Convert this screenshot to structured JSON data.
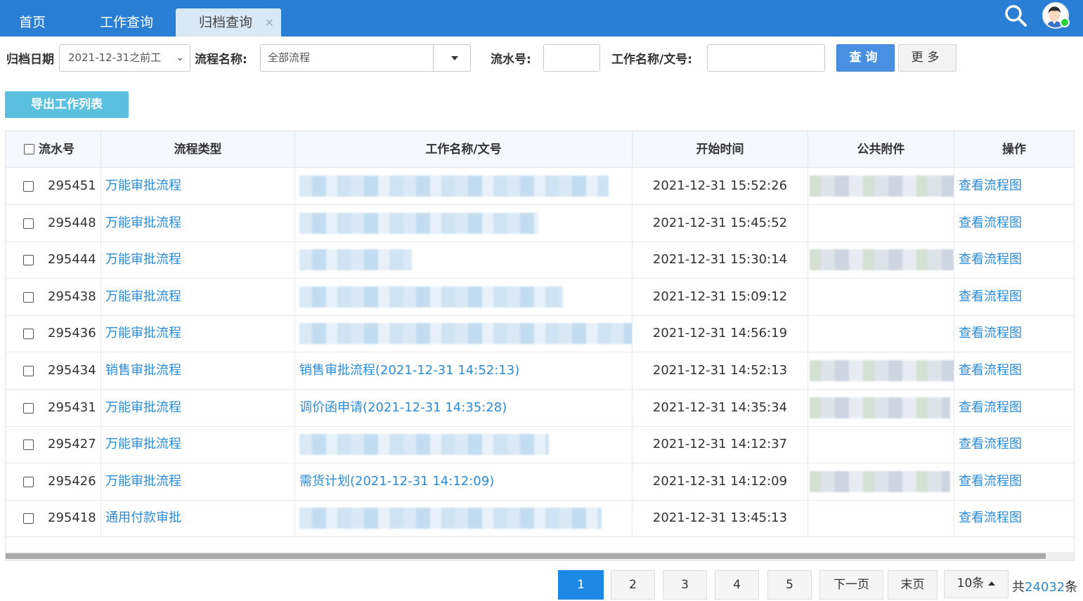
{
  "tabs": [
    {
      "label": "首页"
    },
    {
      "label": "工作查询"
    },
    {
      "label": "归档查询",
      "close": "×"
    }
  ],
  "filters": {
    "date_label": "归档日期",
    "date_value": "2021-12-31之前工",
    "flow_label": "流程名称:",
    "flow_value": "全部流程",
    "serial_label": "流水号:",
    "serial_value": "",
    "name_label": "工作名称/文号:",
    "name_value": "",
    "query_button": "查询",
    "more_button": "更多"
  },
  "export_button": "导出工作列表",
  "table": {
    "headers": {
      "serial": "流水号",
      "type": "流程类型",
      "name": "工作名称/文号",
      "start_time": "开始时间",
      "attachment": "公共附件",
      "operation": "操作"
    },
    "rows": [
      {
        "serial": "295451",
        "type": "万能审批流程",
        "name": "",
        "name_blurred": true,
        "time": "2021-12-31 15:52:26",
        "attachment_blurred": true,
        "op": "查看流程图"
      },
      {
        "serial": "295448",
        "type": "万能审批流程",
        "name": "",
        "name_blurred": true,
        "time": "2021-12-31 15:45:52",
        "attachment_blurred": false,
        "op": "查看流程图"
      },
      {
        "serial": "295444",
        "type": "万能审批流程",
        "name": "",
        "name_blurred": true,
        "time": "2021-12-31 15:30:14",
        "attachment_blurred": true,
        "op": "查看流程图"
      },
      {
        "serial": "295438",
        "type": "万能审批流程",
        "name": "",
        "name_blurred": true,
        "time": "2021-12-31 15:09:12",
        "attachment_blurred": false,
        "op": "查看流程图"
      },
      {
        "serial": "295436",
        "type": "万能审批流程",
        "name": "",
        "name_blurred": true,
        "time": "2021-12-31 14:56:19",
        "attachment_blurred": false,
        "op": "查看流程图"
      },
      {
        "serial": "295434",
        "type": "销售审批流程",
        "name": "销售审批流程(2021-12-31 14:52:13)",
        "name_blurred": false,
        "time": "2021-12-31 14:52:13",
        "attachment_blurred": true,
        "op": "查看流程图"
      },
      {
        "serial": "295431",
        "type": "万能审批流程",
        "name": "调价函申请(2021-12-31 14:35:28)",
        "name_blurred": false,
        "time": "2021-12-31 14:35:34",
        "attachment_blurred": true,
        "op": "查看流程图"
      },
      {
        "serial": "295427",
        "type": "万能审批流程",
        "name": "",
        "name_blurred": true,
        "time": "2021-12-31 14:12:37",
        "attachment_blurred": false,
        "op": "查看流程图"
      },
      {
        "serial": "295426",
        "type": "万能审批流程",
        "name": "需货计划(2021-12-31 14:12:09)",
        "name_blurred": false,
        "time": "2021-12-31 14:12:09",
        "attachment_blurred": true,
        "op": "查看流程图"
      },
      {
        "serial": "295418",
        "type": "通用付款审批",
        "name": "",
        "name_blurred": true,
        "time": "2021-12-31 13:45:13",
        "attachment_blurred": false,
        "op": "查看流程图"
      }
    ]
  },
  "pagination": {
    "pages": [
      "1",
      "2",
      "3",
      "4",
      "5"
    ],
    "active_page": "1",
    "next": "下一页",
    "last": "末页",
    "page_size": "10条",
    "total_prefix": "共",
    "total_count": "24032",
    "total_suffix": "条"
  },
  "colors": {
    "topbar": "#2a7fd4",
    "link": "#2b8bd6",
    "query_button": "#4a90e2",
    "export_button": "#5bc0de",
    "active_page": "#1e88e5"
  }
}
